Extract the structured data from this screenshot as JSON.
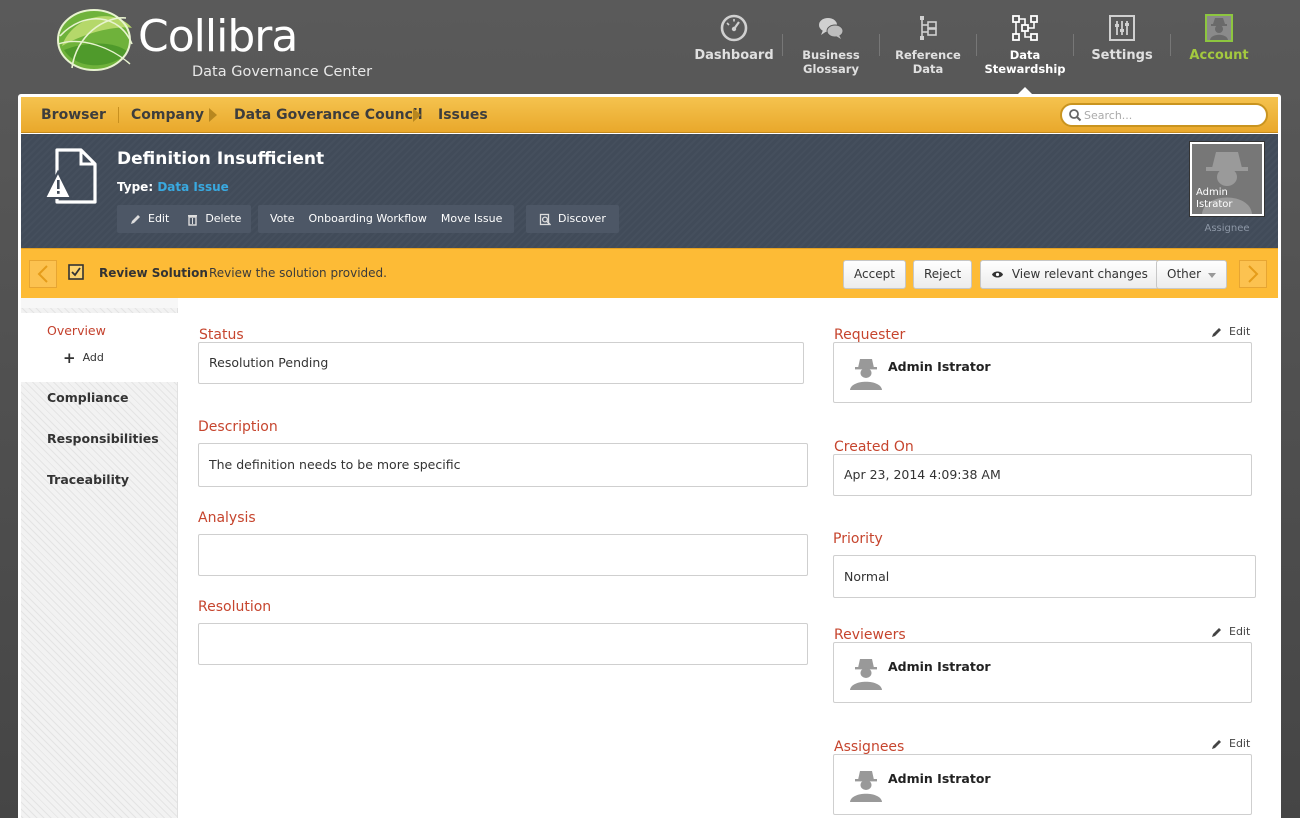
{
  "brand": {
    "name": "Collibra",
    "subtitle": "Data Governance Center",
    "colors": {
      "green": "#8dc63f",
      "dark_green": "#5a9c2f",
      "orange": "#f0b33a",
      "red_label": "#c6452e",
      "link_blue": "#39a9e0"
    }
  },
  "nav": {
    "dashboard": "Dashboard",
    "business_glossary": [
      "Business",
      "Glossary"
    ],
    "reference_data": [
      "Reference",
      "Data"
    ],
    "data_stewardship": [
      "Data",
      "Stewardship"
    ],
    "settings": "Settings",
    "account": "Account"
  },
  "breadcrumb": {
    "items": [
      "Browser",
      "Company",
      "Data Goverance Council",
      "Issues"
    ]
  },
  "search": {
    "placeholder": "Search..."
  },
  "asset": {
    "title": "Definition Insufficient",
    "type_label": "Type:",
    "type_value": "Data Issue",
    "actions": {
      "edit": "Edit",
      "delete": "Delete",
      "vote": "Vote",
      "onboarding_workflow": "Onboarding Workflow",
      "move_issue": "Move Issue",
      "discover": "Discover"
    },
    "assignee": {
      "name_line1": "Admin",
      "name_line2": "Istrator",
      "caption": "Assignee"
    }
  },
  "task": {
    "title": "Review Solution",
    "description": "Review the solution provided.",
    "buttons": {
      "accept": "Accept",
      "reject": "Reject",
      "view_changes": "View relevant changes",
      "other": "Other"
    }
  },
  "sidebar": {
    "overview": "Overview",
    "add": "Add",
    "compliance": "Compliance",
    "responsibilities": "Responsibilities",
    "traceability": "Traceability"
  },
  "fields": {
    "status": {
      "label": "Status",
      "value": "Resolution Pending"
    },
    "description": {
      "label": "Description",
      "value": "The definition needs to be more specific"
    },
    "analysis": {
      "label": "Analysis",
      "value": ""
    },
    "resolution": {
      "label": "Resolution",
      "value": ""
    },
    "requester": {
      "label": "Requester",
      "value": "Admin Istrator",
      "edit": "Edit"
    },
    "created_on": {
      "label": "Created On",
      "value": "Apr 23, 2014 4:09:38 AM"
    },
    "priority": {
      "label": "Priority",
      "value": "Normal"
    },
    "reviewers": {
      "label": "Reviewers",
      "value": "Admin Istrator",
      "edit": "Edit"
    },
    "assignees": {
      "label": "Assignees",
      "value": "Admin Istrator",
      "edit": "Edit"
    }
  }
}
